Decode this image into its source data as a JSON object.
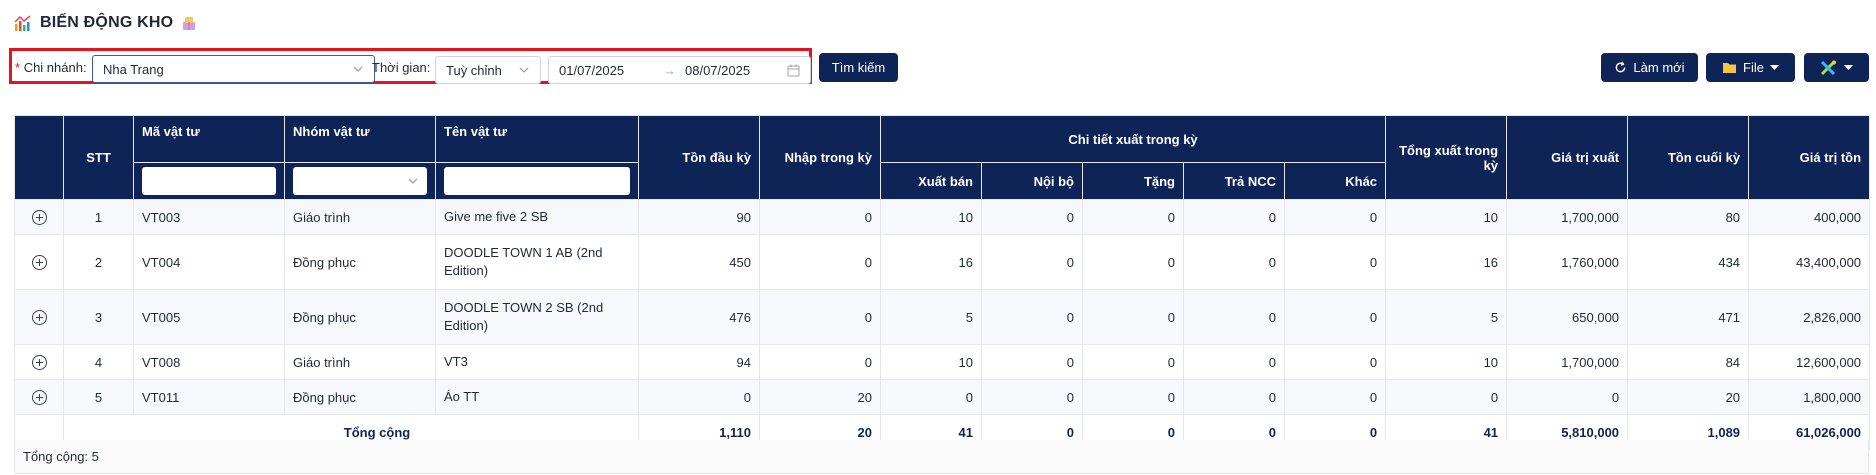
{
  "page": {
    "title": "BIẾN ĐỘNG KHO",
    "colors": {
      "navy": "#0e2457",
      "highlight_border": "#e3141b"
    }
  },
  "filters": {
    "branch_label": "Chi nhánh:",
    "branch_required_mark": "*",
    "branch_value": "Nha Trang",
    "time_label": "Thời gian:",
    "time_value": "Tuỳ chỉnh",
    "date_from": "01/07/2025",
    "date_to": "08/07/2025",
    "date_arrow": "→",
    "search_label": "Tìm kiếm"
  },
  "toolbar": {
    "refresh_label": "Làm mới",
    "file_label": "File"
  },
  "table": {
    "headers": {
      "stt": "STT",
      "code": "Mã vật tư",
      "group": "Nhóm vật tư",
      "name": "Tên vật tư",
      "opening": "Tồn đầu kỳ",
      "import": "Nhập trong kỳ",
      "export_detail": "Chi tiết xuất trong kỳ",
      "sale": "Xuất bán",
      "internal": "Nội bộ",
      "gift": "Tặng",
      "return_ncc": "Trả NCC",
      "other": "Khác",
      "total_export": "Tổng xuất trong kỳ",
      "export_value": "Giá trị xuất",
      "closing": "Tồn cuối kỳ",
      "stock_value": "Giá trị tồn"
    },
    "rows": [
      {
        "stt": "1",
        "code": "VT003",
        "group": "Giáo trình",
        "name": "Give me five 2 SB",
        "opening": "90",
        "import": "0",
        "sale": "10",
        "internal": "0",
        "gift": "0",
        "return_ncc": "0",
        "other": "0",
        "total_export": "10",
        "export_value": "1,700,000",
        "closing": "80",
        "stock_value": "400,000"
      },
      {
        "stt": "2",
        "code": "VT004",
        "group": "Đồng phục",
        "name": "DOODLE TOWN 1 AB (2nd Edition)",
        "opening": "450",
        "import": "0",
        "sale": "16",
        "internal": "0",
        "gift": "0",
        "return_ncc": "0",
        "other": "0",
        "total_export": "16",
        "export_value": "1,760,000",
        "closing": "434",
        "stock_value": "43,400,000"
      },
      {
        "stt": "3",
        "code": "VT005",
        "group": "Đồng phục",
        "name": "DOODLE TOWN 2 SB (2nd Edition)",
        "opening": "476",
        "import": "0",
        "sale": "5",
        "internal": "0",
        "gift": "0",
        "return_ncc": "0",
        "other": "0",
        "total_export": "5",
        "export_value": "650,000",
        "closing": "471",
        "stock_value": "2,826,000"
      },
      {
        "stt": "4",
        "code": "VT008",
        "group": "Giáo trình",
        "name": "VT3",
        "opening": "94",
        "import": "0",
        "sale": "10",
        "internal": "0",
        "gift": "0",
        "return_ncc": "0",
        "other": "0",
        "total_export": "10",
        "export_value": "1,700,000",
        "closing": "84",
        "stock_value": "12,600,000"
      },
      {
        "stt": "5",
        "code": "VT011",
        "group": "Đồng phục",
        "name": "Áo TT",
        "opening": "0",
        "import": "20",
        "sale": "0",
        "internal": "0",
        "gift": "0",
        "return_ncc": "0",
        "other": "0",
        "total_export": "0",
        "export_value": "0",
        "closing": "20",
        "stock_value": "1,800,000"
      }
    ],
    "totals": {
      "label": "Tổng cộng",
      "opening": "1,110",
      "import": "20",
      "sale": "41",
      "internal": "0",
      "gift": "0",
      "return_ncc": "0",
      "other": "0",
      "total_export": "41",
      "export_value": "5,810,000",
      "closing": "1,089",
      "stock_value": "61,026,000"
    }
  },
  "footer": {
    "count_text": "Tổng cộng: 5"
  },
  "icons": [
    "chart-icon",
    "box-emoji-icon",
    "chevron-down-icon",
    "calendar-icon",
    "refresh-icon",
    "folder-icon",
    "caret-down-icon",
    "tools-icon",
    "expand-row-icon"
  ]
}
